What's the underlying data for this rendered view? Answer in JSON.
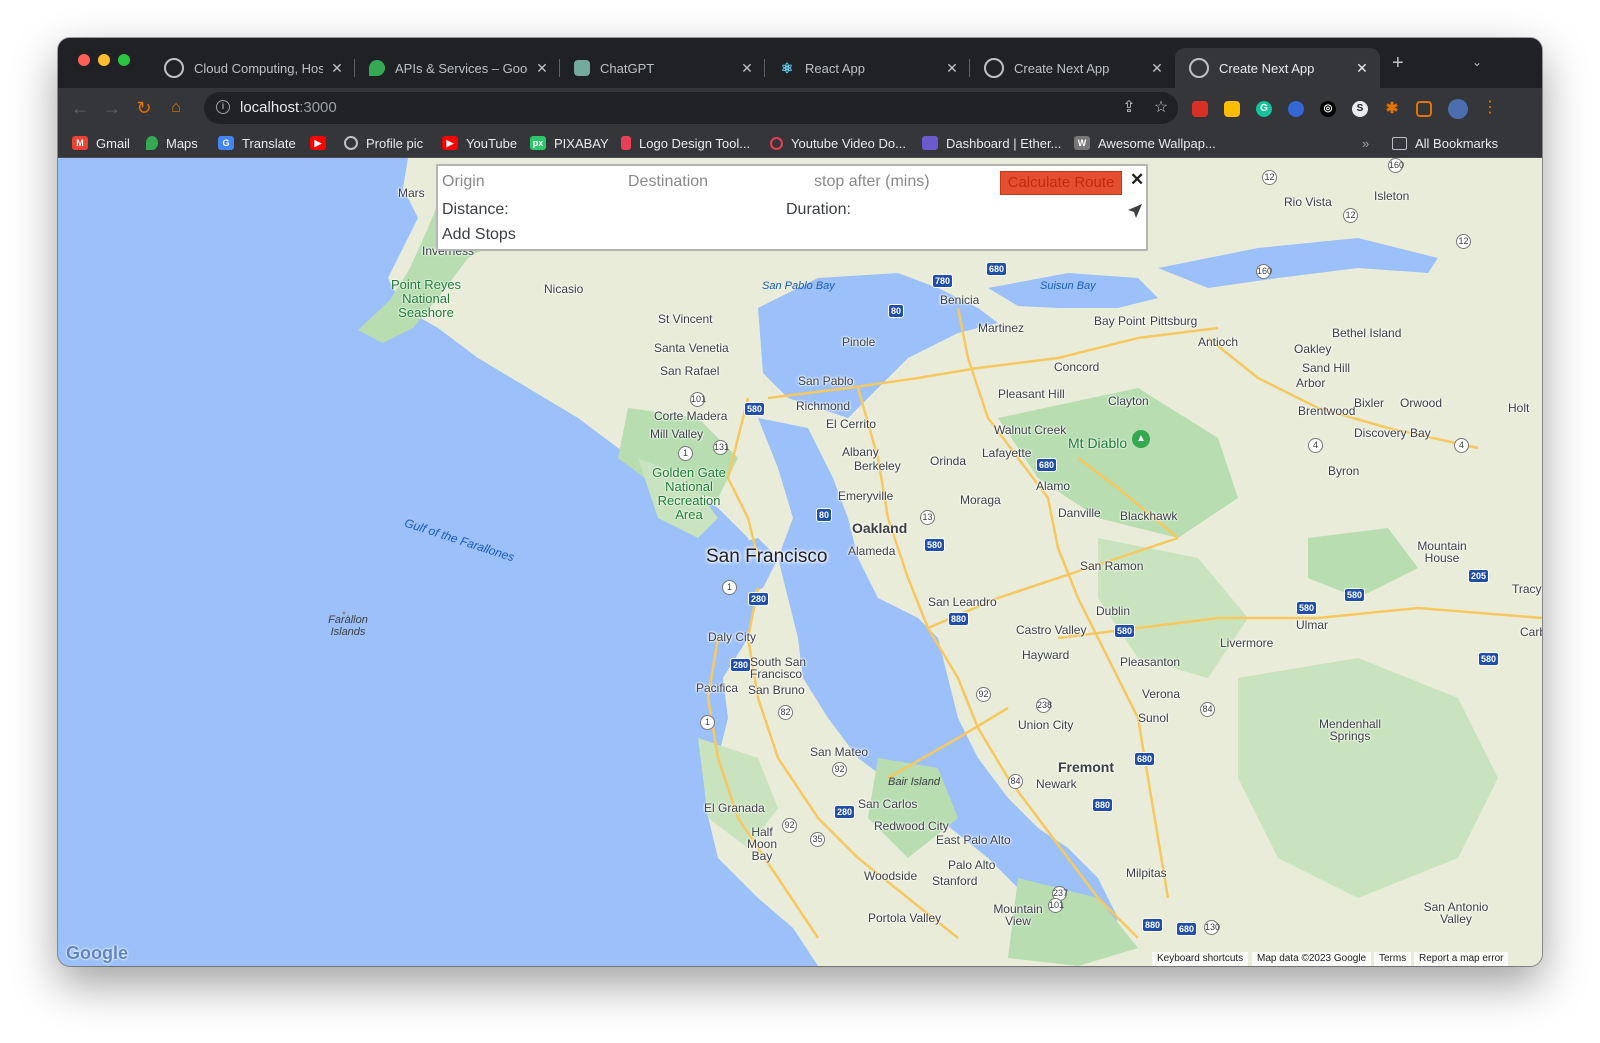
{
  "browser": {
    "tabs": [
      {
        "title": "Cloud Computing, Hosti",
        "active": false,
        "fav_color": "#ffffff"
      },
      {
        "title": "APIs & Services – Goog",
        "active": false,
        "fav_color": "#34a853"
      },
      {
        "title": "ChatGPT",
        "active": false,
        "fav_color": "#74aa9c"
      },
      {
        "title": "React App",
        "active": false,
        "fav_color": "#61dafb"
      },
      {
        "title": "Create Next App",
        "active": false,
        "fav_color": "#e8eaed"
      },
      {
        "title": "Create Next App",
        "active": true,
        "fav_color": "#e8eaed"
      }
    ],
    "new_tab_glyph": "+",
    "address": {
      "host": "localhost",
      "port": ":3000"
    },
    "bookmarks": [
      {
        "label": "Gmail",
        "icon": "gmail-icon",
        "color": "#ea4335"
      },
      {
        "label": "Maps",
        "icon": "maps-icon",
        "color": "#34a853"
      },
      {
        "label": "Translate",
        "icon": "translate-icon",
        "color": "#4285f4"
      },
      {
        "label": "",
        "icon": "youtube-icon",
        "color": "#ff0000"
      },
      {
        "label": "Profile pic",
        "icon": "globe-icon",
        "color": "#9aa0a6"
      },
      {
        "label": "YouTube",
        "icon": "youtube-icon",
        "color": "#ff0000"
      },
      {
        "label": "PIXABAY",
        "icon": "pixabay-icon",
        "color": "#2ec66d"
      },
      {
        "label": "Logo Design Tool...",
        "icon": "rocket-icon",
        "color": "#e94057"
      },
      {
        "label": "Youtube Video Do...",
        "icon": "pin-icon",
        "color": "#e94057"
      },
      {
        "label": "Dashboard | Ether...",
        "icon": "etherscan-icon",
        "color": "#6a5acd"
      },
      {
        "label": "Awesome Wallpap...",
        "icon": "wallpaper-icon",
        "color": "#777777"
      }
    ],
    "all_bookmarks": "All Bookmarks"
  },
  "route_panel": {
    "origin_placeholder": "Origin",
    "destination_placeholder": "Destination",
    "stop_placeholder": "stop after (mins)",
    "calculate_label": "Calculate Route",
    "distance_label": "Distance:",
    "duration_label": "Duration:",
    "add_stops_label": "Add Stops",
    "close_glyph": "✕"
  },
  "map": {
    "big_city": "San Francisco",
    "mid_cities": [
      "Oakland",
      "Fremont"
    ],
    "cities": [
      "Mars",
      "Inverness",
      "Nicasio",
      "St Vincent",
      "Santa Venetia",
      "San Rafael",
      "Corte Madera",
      "Mill Valley",
      "San Pablo",
      "Richmond",
      "El Cerrito",
      "Albany",
      "Berkeley",
      "Emeryville",
      "Alameda",
      "Pinole",
      "Benicia",
      "Martinez",
      "Concord",
      "Pleasant Hill",
      "Walnut Creek",
      "Lafayette",
      "Orinda",
      "Moraga",
      "Clayton",
      "Alamo",
      "Danville",
      "Blackhawk",
      "San Ramon",
      "Dublin",
      "Castro Valley",
      "San Leandro",
      "Hayward",
      "Union City",
      "Newark",
      "Pleasanton",
      "Livermore",
      "Sunol",
      "Verona",
      "Daly City",
      "South San Francisco",
      "Pacifica",
      "San Bruno",
      "San Mateo",
      "San Carlos",
      "Redwood City",
      "East Palo Alto",
      "Palo Alto",
      "Stanford",
      "Woodside",
      "Portola Valley",
      "Mountain View",
      "Milpitas",
      "El Granada",
      "Half Moon Bay",
      "Bay Point",
      "Pittsburg",
      "Antioch",
      "Oakley",
      "Brentwood",
      "Byron",
      "Bethel Island",
      "Sand Hill",
      "Arbor",
      "Bixler",
      "Orwood",
      "Discovery Bay",
      "Holt",
      "Mountain House",
      "Tracy",
      "Ulmar",
      "Carb",
      "Rio Vista",
      "Isleton",
      "Mendenhall Springs",
      "San Antonio Valley"
    ],
    "water": [
      "San Pablo Bay",
      "Suisun Bay",
      "Gulf of the Farallones",
      "Bair Island"
    ],
    "parks": [
      "Point Reyes National Seashore",
      "Golden Gate National Recreation Area",
      "Mt Diablo"
    ],
    "islands": "Farallon Islands",
    "google_logo": "Google",
    "attribution": [
      "Keyboard shortcuts",
      "Map data ©2023 Google",
      "Terms",
      "Report a map error"
    ]
  },
  "colors": {
    "water": "#9cc0f9",
    "land": "#e8ecd8",
    "park": "#b7ddb0",
    "highway": "#f6c85f",
    "button": "#e4502f"
  }
}
